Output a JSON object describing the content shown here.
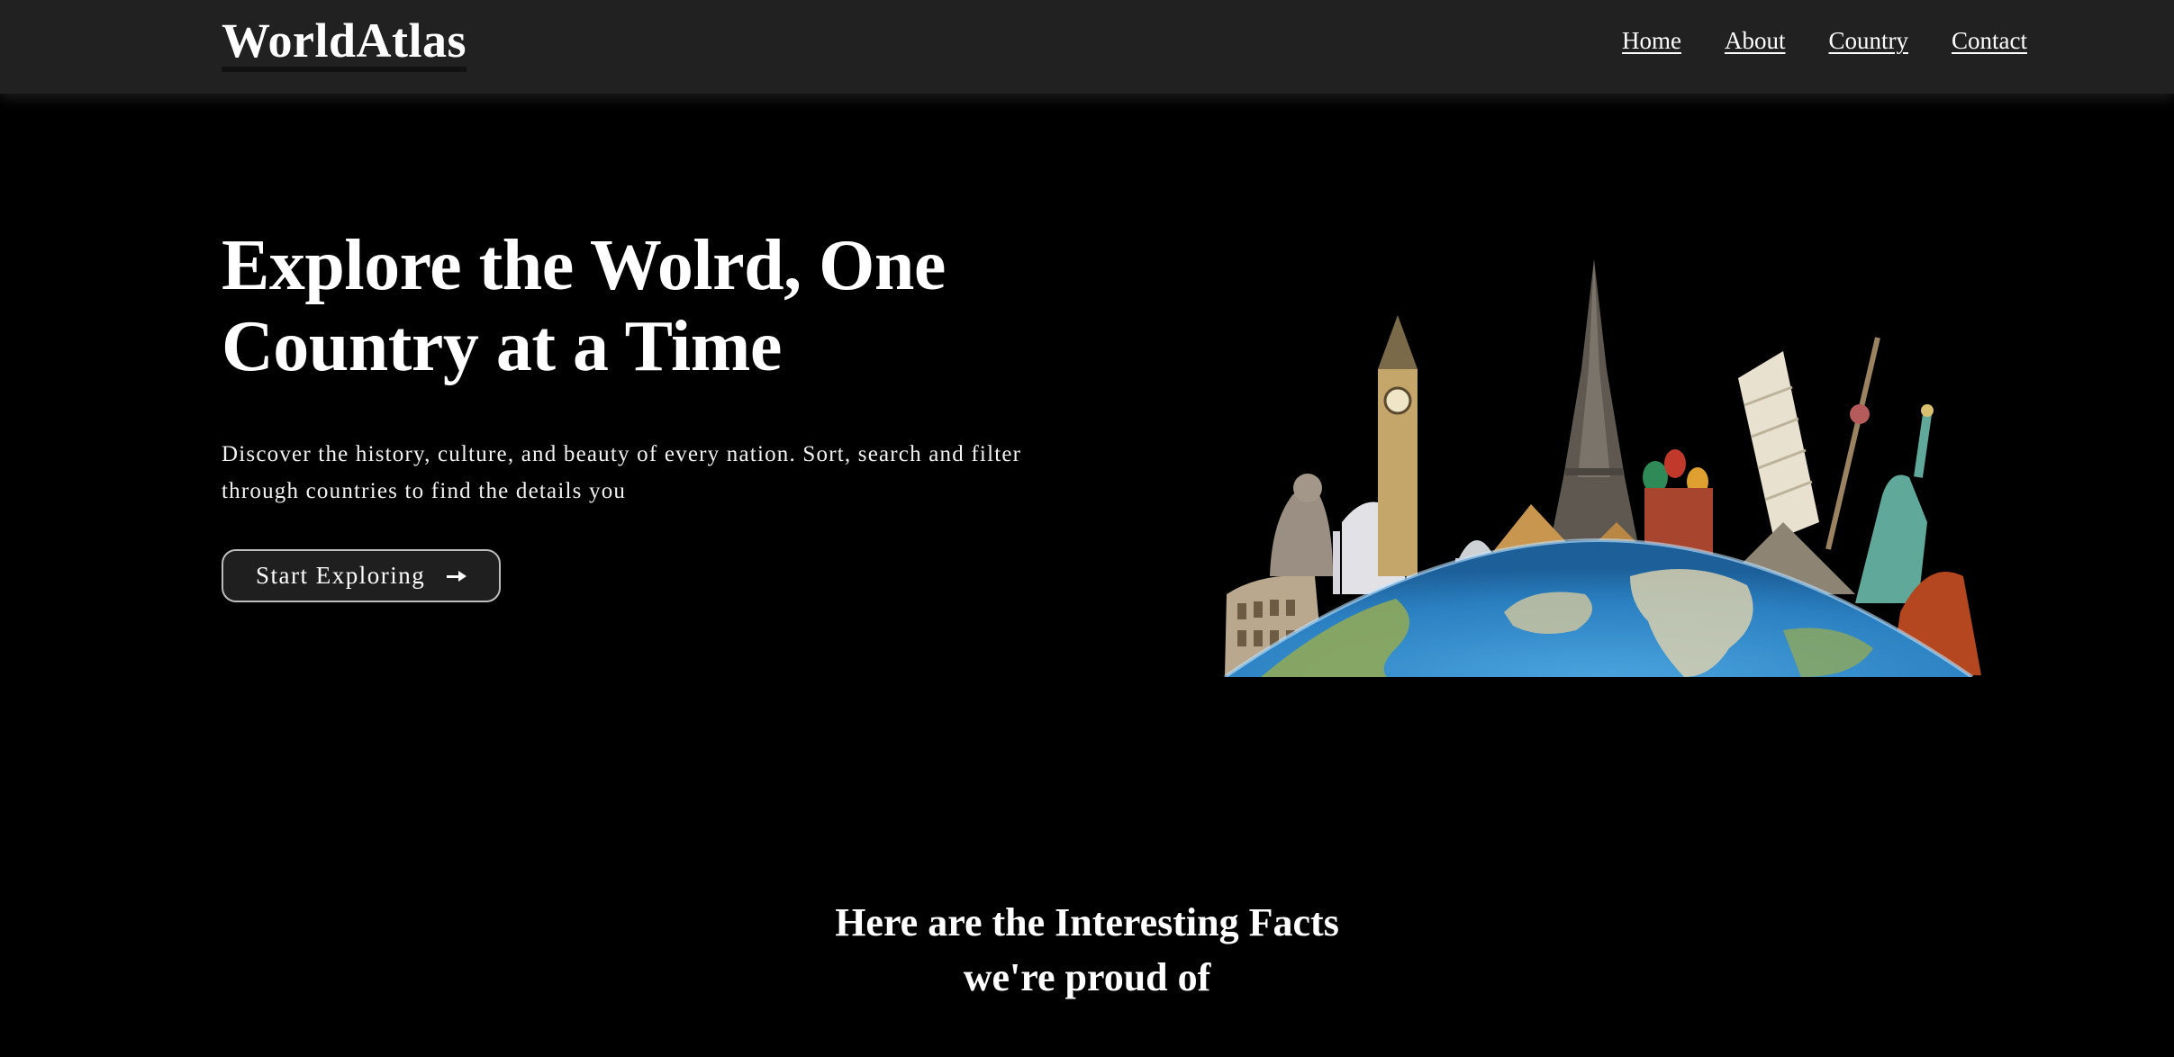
{
  "nav": {
    "brand": "WorldAtlas",
    "links": [
      {
        "label": "Home"
      },
      {
        "label": "About"
      },
      {
        "label": "Country"
      },
      {
        "label": "Contact"
      }
    ]
  },
  "hero": {
    "title_line1": "Explore the Wolrd, One",
    "title_line2": "Country at a Time",
    "description": "Discover the history, culture, and beauty of every nation. Sort, search and filter through countries to find the details you",
    "cta_label": "Start Exploring",
    "cta_icon": "arrow-right-icon",
    "image_icon": "world-landmarks-globe-illustration"
  },
  "facts": {
    "title_line1": "Here are the Interesting Facts",
    "title_line2": "we're proud of"
  },
  "colors": {
    "background": "#000000",
    "navbar": "#212121",
    "button_bg": "#1f1f1f",
    "button_border": "#bdbdbd",
    "ocean": "#2f86c9",
    "land": "#8fa95a"
  }
}
